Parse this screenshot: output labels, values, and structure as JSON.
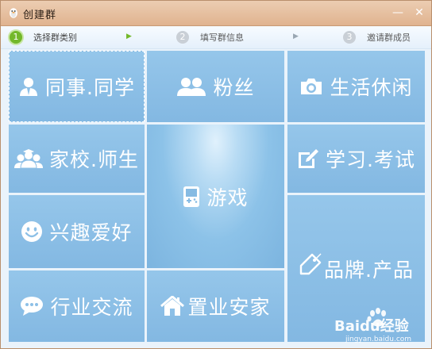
{
  "window": {
    "title": "创建群",
    "minimize_label": "—",
    "close_label": "✕"
  },
  "steps": [
    {
      "number": "1",
      "label": "选择群类别",
      "state": "active"
    },
    {
      "number": "2",
      "label": "填写群信息",
      "state": "inactive"
    },
    {
      "number": "3",
      "label": "邀请群成员",
      "state": "inactive"
    }
  ],
  "categories": [
    {
      "label": "同事.同学",
      "icon": "person-icon"
    },
    {
      "label": "粉丝",
      "icon": "people-icon"
    },
    {
      "label": "生活休闲",
      "icon": "camera-icon"
    },
    {
      "label": "家校.师生",
      "icon": "teacher-students-icon"
    },
    {
      "label": "游戏",
      "icon": "gamepad-icon"
    },
    {
      "label": "学习.考试",
      "icon": "pencil-icon"
    },
    {
      "label": "兴趣爱好",
      "icon": "smiley-icon"
    },
    {
      "label": "品牌.产品",
      "icon": "tag-icon"
    },
    {
      "label": "行业交流",
      "icon": "chat-bubble-icon"
    },
    {
      "label": "置业安家",
      "icon": "house-icon"
    }
  ],
  "watermark": {
    "brand": "Baidu经验",
    "url": "jingyan.baidu.com"
  },
  "colors": {
    "tile": "#8dc0e7",
    "step_active": "#73b82a",
    "titlebar": "#e6c0a0"
  }
}
